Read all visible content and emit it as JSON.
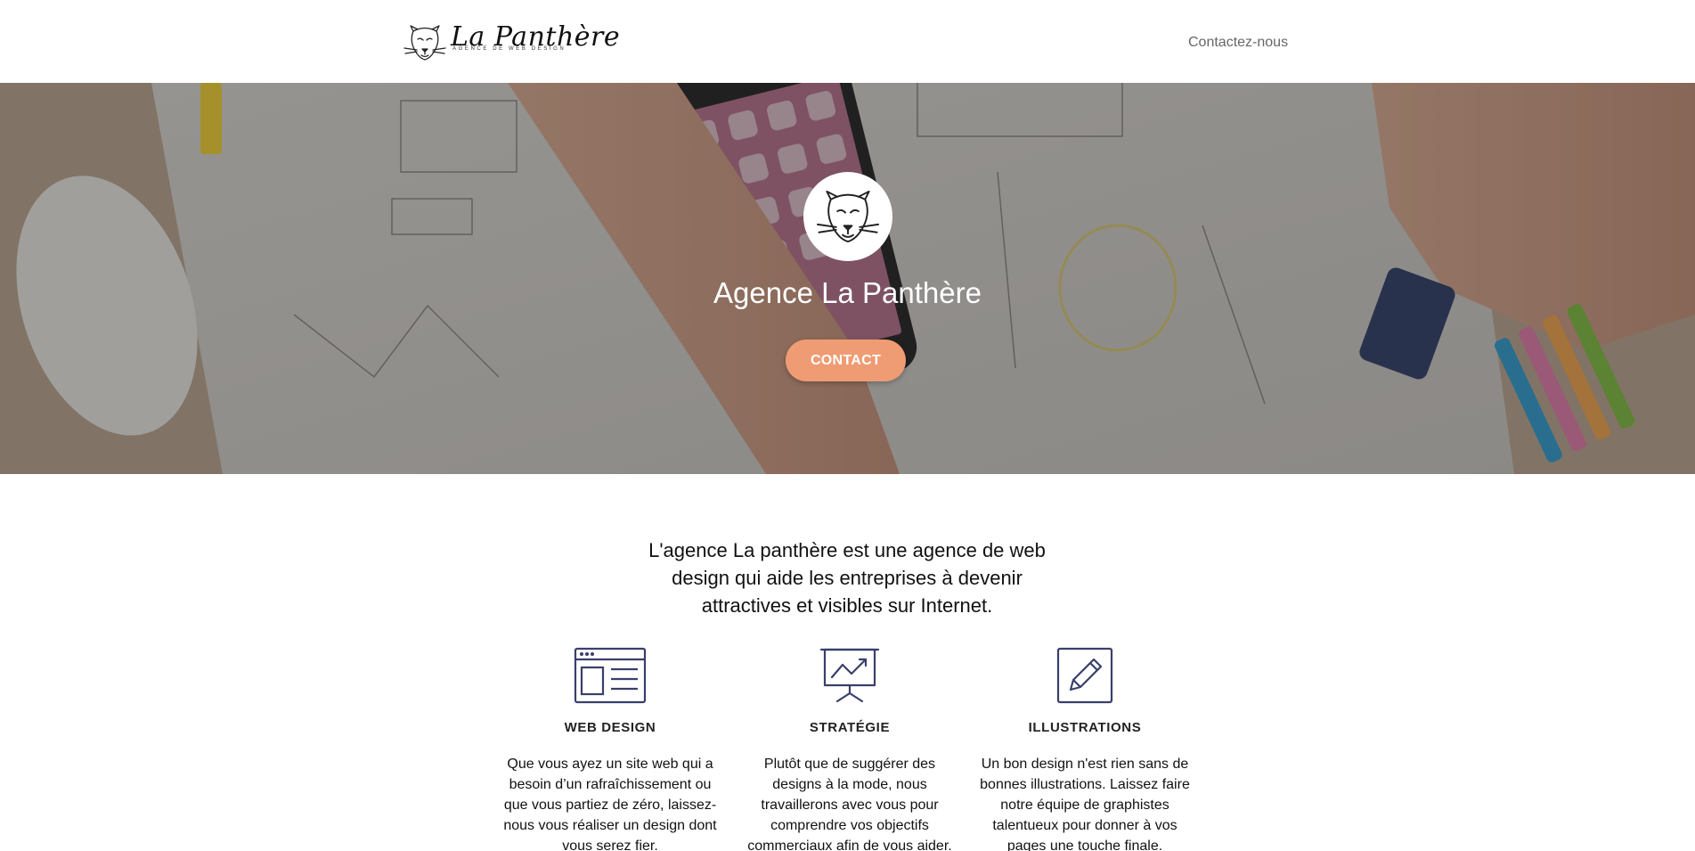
{
  "header": {
    "logo_name": "La Panthère",
    "logo_tagline": "AGENCE DE WEB DESIGN",
    "nav_contact": "Contactez-nous"
  },
  "hero": {
    "title": "Agence La Panthère",
    "button_label": "CONTACT"
  },
  "intro": {
    "text": "L'agence La panthère est une agence de web design qui aide les entreprises à devenir attractives et visibles sur Internet."
  },
  "services": [
    {
      "icon": "web-layout-icon",
      "title": "WEB DESIGN",
      "text": "Que vous ayez un site web qui a besoin d’un rafraîchissement ou que vous partiez de zéro, laissez-nous vous réaliser un design dont vous serez fier."
    },
    {
      "icon": "presentation-chart-icon",
      "title": "STRATÉGIE",
      "text": "Plutôt que de suggérer des designs à la mode, nous travaillerons avec vous pour comprendre vos objectifs commerciaux afin de vous aider."
    },
    {
      "icon": "pencil-icon",
      "title": "ILLUSTRATIONS",
      "text": "Un bon design n'est rien sans de bonnes illustrations. Laissez faire notre équipe de graphistes talentueux pour donner à vos pages une touche finale."
    }
  ],
  "colors": {
    "accent_button": "#ef9c74",
    "icon_navy": "#3a3f6b",
    "nav_text": "#666666"
  }
}
